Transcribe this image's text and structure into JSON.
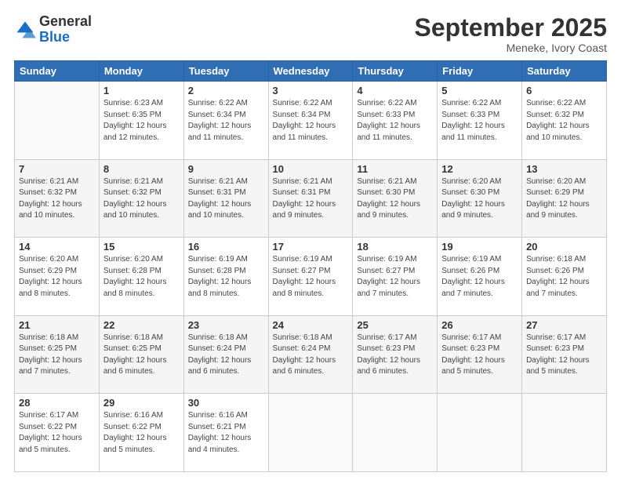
{
  "logo": {
    "general": "General",
    "blue": "Blue"
  },
  "header": {
    "month": "September 2025",
    "location": "Meneke, Ivory Coast"
  },
  "weekdays": [
    "Sunday",
    "Monday",
    "Tuesday",
    "Wednesday",
    "Thursday",
    "Friday",
    "Saturday"
  ],
  "weeks": [
    [
      {
        "day": "",
        "info": ""
      },
      {
        "day": "1",
        "info": "Sunrise: 6:23 AM\nSunset: 6:35 PM\nDaylight: 12 hours\nand 12 minutes."
      },
      {
        "day": "2",
        "info": "Sunrise: 6:22 AM\nSunset: 6:34 PM\nDaylight: 12 hours\nand 11 minutes."
      },
      {
        "day": "3",
        "info": "Sunrise: 6:22 AM\nSunset: 6:34 PM\nDaylight: 12 hours\nand 11 minutes."
      },
      {
        "day": "4",
        "info": "Sunrise: 6:22 AM\nSunset: 6:33 PM\nDaylight: 12 hours\nand 11 minutes."
      },
      {
        "day": "5",
        "info": "Sunrise: 6:22 AM\nSunset: 6:33 PM\nDaylight: 12 hours\nand 11 minutes."
      },
      {
        "day": "6",
        "info": "Sunrise: 6:22 AM\nSunset: 6:32 PM\nDaylight: 12 hours\nand 10 minutes."
      }
    ],
    [
      {
        "day": "7",
        "info": "Sunrise: 6:21 AM\nSunset: 6:32 PM\nDaylight: 12 hours\nand 10 minutes."
      },
      {
        "day": "8",
        "info": "Sunrise: 6:21 AM\nSunset: 6:32 PM\nDaylight: 12 hours\nand 10 minutes."
      },
      {
        "day": "9",
        "info": "Sunrise: 6:21 AM\nSunset: 6:31 PM\nDaylight: 12 hours\nand 10 minutes."
      },
      {
        "day": "10",
        "info": "Sunrise: 6:21 AM\nSunset: 6:31 PM\nDaylight: 12 hours\nand 9 minutes."
      },
      {
        "day": "11",
        "info": "Sunrise: 6:21 AM\nSunset: 6:30 PM\nDaylight: 12 hours\nand 9 minutes."
      },
      {
        "day": "12",
        "info": "Sunrise: 6:20 AM\nSunset: 6:30 PM\nDaylight: 12 hours\nand 9 minutes."
      },
      {
        "day": "13",
        "info": "Sunrise: 6:20 AM\nSunset: 6:29 PM\nDaylight: 12 hours\nand 9 minutes."
      }
    ],
    [
      {
        "day": "14",
        "info": "Sunrise: 6:20 AM\nSunset: 6:29 PM\nDaylight: 12 hours\nand 8 minutes."
      },
      {
        "day": "15",
        "info": "Sunrise: 6:20 AM\nSunset: 6:28 PM\nDaylight: 12 hours\nand 8 minutes."
      },
      {
        "day": "16",
        "info": "Sunrise: 6:19 AM\nSunset: 6:28 PM\nDaylight: 12 hours\nand 8 minutes."
      },
      {
        "day": "17",
        "info": "Sunrise: 6:19 AM\nSunset: 6:27 PM\nDaylight: 12 hours\nand 8 minutes."
      },
      {
        "day": "18",
        "info": "Sunrise: 6:19 AM\nSunset: 6:27 PM\nDaylight: 12 hours\nand 7 minutes."
      },
      {
        "day": "19",
        "info": "Sunrise: 6:19 AM\nSunset: 6:26 PM\nDaylight: 12 hours\nand 7 minutes."
      },
      {
        "day": "20",
        "info": "Sunrise: 6:18 AM\nSunset: 6:26 PM\nDaylight: 12 hours\nand 7 minutes."
      }
    ],
    [
      {
        "day": "21",
        "info": "Sunrise: 6:18 AM\nSunset: 6:25 PM\nDaylight: 12 hours\nand 7 minutes."
      },
      {
        "day": "22",
        "info": "Sunrise: 6:18 AM\nSunset: 6:25 PM\nDaylight: 12 hours\nand 6 minutes."
      },
      {
        "day": "23",
        "info": "Sunrise: 6:18 AM\nSunset: 6:24 PM\nDaylight: 12 hours\nand 6 minutes."
      },
      {
        "day": "24",
        "info": "Sunrise: 6:18 AM\nSunset: 6:24 PM\nDaylight: 12 hours\nand 6 minutes."
      },
      {
        "day": "25",
        "info": "Sunrise: 6:17 AM\nSunset: 6:23 PM\nDaylight: 12 hours\nand 6 minutes."
      },
      {
        "day": "26",
        "info": "Sunrise: 6:17 AM\nSunset: 6:23 PM\nDaylight: 12 hours\nand 5 minutes."
      },
      {
        "day": "27",
        "info": "Sunrise: 6:17 AM\nSunset: 6:23 PM\nDaylight: 12 hours\nand 5 minutes."
      }
    ],
    [
      {
        "day": "28",
        "info": "Sunrise: 6:17 AM\nSunset: 6:22 PM\nDaylight: 12 hours\nand 5 minutes."
      },
      {
        "day": "29",
        "info": "Sunrise: 6:16 AM\nSunset: 6:22 PM\nDaylight: 12 hours\nand 5 minutes."
      },
      {
        "day": "30",
        "info": "Sunrise: 6:16 AM\nSunset: 6:21 PM\nDaylight: 12 hours\nand 4 minutes."
      },
      {
        "day": "",
        "info": ""
      },
      {
        "day": "",
        "info": ""
      },
      {
        "day": "",
        "info": ""
      },
      {
        "day": "",
        "info": ""
      }
    ]
  ]
}
